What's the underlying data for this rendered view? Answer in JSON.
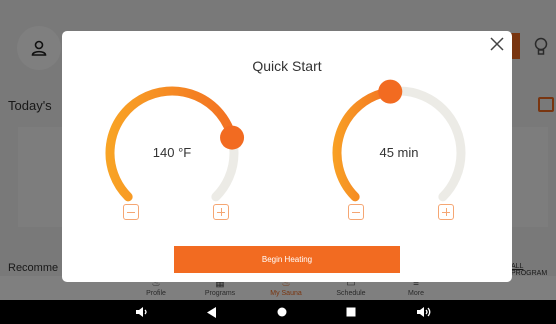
{
  "background_app": {
    "section_today": "Today's",
    "section_recommended": "Recomme",
    "all_programs_link": "ALL PROGRAM",
    "tabs": [
      {
        "label": "Profile",
        "icon": "person-icon"
      },
      {
        "label": "Programs",
        "icon": "grid-icon"
      },
      {
        "label": "My Sauna",
        "icon": "sauna-icon",
        "active": true
      },
      {
        "label": "Schedule",
        "icon": "calendar-icon"
      },
      {
        "label": "More",
        "icon": "menu-icon"
      }
    ]
  },
  "modal": {
    "title": "Quick Start",
    "temperature": {
      "display": "140 °F",
      "level": 0.78
    },
    "duration": {
      "display": "45 min",
      "level": 0.47
    },
    "begin_button": "Begin Heating"
  },
  "colors": {
    "accent": "#f26b21",
    "gradient_start": "#f9a825",
    "track": "#ecebe6",
    "stepper": "#f5a673"
  },
  "navbar": {
    "icons": [
      "volume-down-icon",
      "back-icon",
      "home-icon",
      "recents-icon",
      "volume-up-icon"
    ]
  }
}
